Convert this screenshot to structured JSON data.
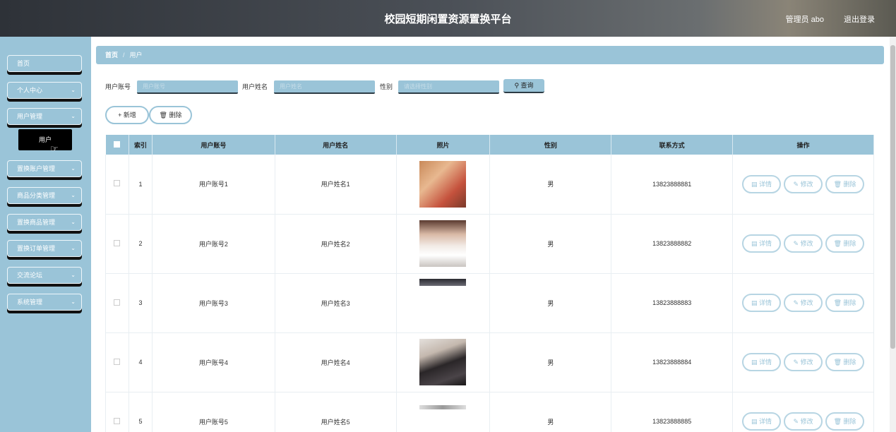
{
  "header": {
    "title": "校园短期闲置资源置换平台",
    "user": "管理员 abo",
    "logout": "退出登录"
  },
  "sidebar": {
    "items": [
      {
        "label": "首页"
      },
      {
        "label": "个人中心"
      },
      {
        "label": "用户管理"
      },
      {
        "label": "置换账户管理"
      },
      {
        "label": "商品分类管理"
      },
      {
        "label": "置换商品管理"
      },
      {
        "label": "置换订单管理"
      },
      {
        "label": "交流论坛"
      },
      {
        "label": "系统管理"
      }
    ],
    "sub_item": "用户"
  },
  "breadcrumb": {
    "home": "首页",
    "current": "用户"
  },
  "search": {
    "account_label": "用户账号",
    "account_placeholder": "用户账号",
    "name_label": "用户姓名",
    "name_placeholder": "用户姓名",
    "gender_label": "性别",
    "gender_placeholder": "请选择性别",
    "query": "查询"
  },
  "actions": {
    "add": "新增",
    "delete": "删除"
  },
  "table": {
    "headers": [
      "索引",
      "用户账号",
      "用户姓名",
      "照片",
      "性别",
      "联系方式",
      "操作"
    ],
    "rows": [
      {
        "index": "1",
        "account": "用户账号1",
        "name": "用户姓名1",
        "gender": "男",
        "phone": "13823888881"
      },
      {
        "index": "2",
        "account": "用户账号2",
        "name": "用户姓名2",
        "gender": "男",
        "phone": "13823888882"
      },
      {
        "index": "3",
        "account": "用户账号3",
        "name": "用户姓名3",
        "gender": "男",
        "phone": "13823888883"
      },
      {
        "index": "4",
        "account": "用户账号4",
        "name": "用户姓名4",
        "gender": "男",
        "phone": "13823888884"
      },
      {
        "index": "5",
        "account": "用户账号5",
        "name": "用户姓名5",
        "gender": "男",
        "phone": "13823888885"
      }
    ],
    "op_detail": "详情",
    "op_edit": "修改",
    "op_delete": "删除"
  }
}
